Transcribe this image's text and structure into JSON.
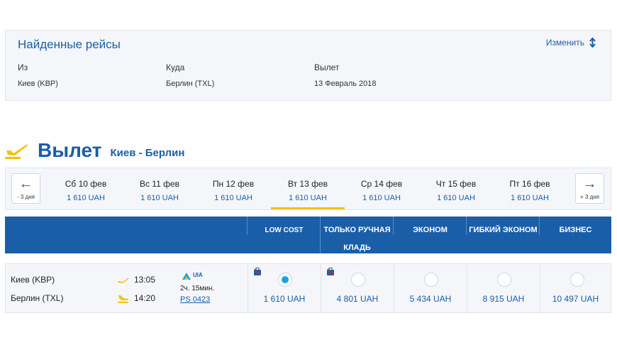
{
  "summary": {
    "title": "Найденные рейсы",
    "change_label": "Изменить",
    "from_label": "Из",
    "from_value": "Киев (KBP)",
    "to_label": "Куда",
    "to_value": "Берлин (TXL)",
    "depart_label": "Вылет",
    "depart_value": "13 Февраль 2018"
  },
  "departure": {
    "heading": "Вылет",
    "route": "Киев - Берлин"
  },
  "datestrip": {
    "prev_label": "- 3 дня",
    "next_label": "+ 3 дня",
    "days": [
      {
        "date": "Сб 10 фев",
        "price": "1 610 UAH"
      },
      {
        "date": "Вс 11 фев",
        "price": "1 610 UAH"
      },
      {
        "date": "Пн 12 фев",
        "price": "1 610 UAH"
      },
      {
        "date": "Вт 13 фев",
        "price": "1 610 UAH"
      },
      {
        "date": "Ср 14 фев",
        "price": "1 610 UAH"
      },
      {
        "date": "Чт 15 фев",
        "price": "1 610 UAH"
      },
      {
        "date": "Пт 16 фев",
        "price": "1 610 UAH"
      }
    ],
    "active_index": 3
  },
  "fares": {
    "columns": [
      {
        "line1": "LOW COST",
        "line2": ""
      },
      {
        "line1": "ТОЛЬКО РУЧНАЯ",
        "line2": "КЛАДЬ"
      },
      {
        "line1": "ЭКОНОМ",
        "line2": ""
      },
      {
        "line1": "ГИБКИЙ ЭКОНОМ",
        "line2": ""
      },
      {
        "line1": "БИЗНЕС",
        "line2": ""
      }
    ]
  },
  "flight": {
    "origin": "Киев (KBP)",
    "destination": "Берлин (TXL)",
    "dep_time": "13:05",
    "arr_time": "14:20",
    "airline_code": "UIA",
    "duration": "2ч. 15мин.",
    "flight_number": "PS 0423",
    "prices": [
      "1 610 UAH",
      "4 801 UAH",
      "5 434 UAH",
      "8 915 UAH",
      "10 497 UAH"
    ],
    "selected_index": 0
  },
  "colors": {
    "brand_blue": "#1a5ea8",
    "accent_yellow": "#f2c200",
    "radio_selected": "#1aa3e0"
  }
}
